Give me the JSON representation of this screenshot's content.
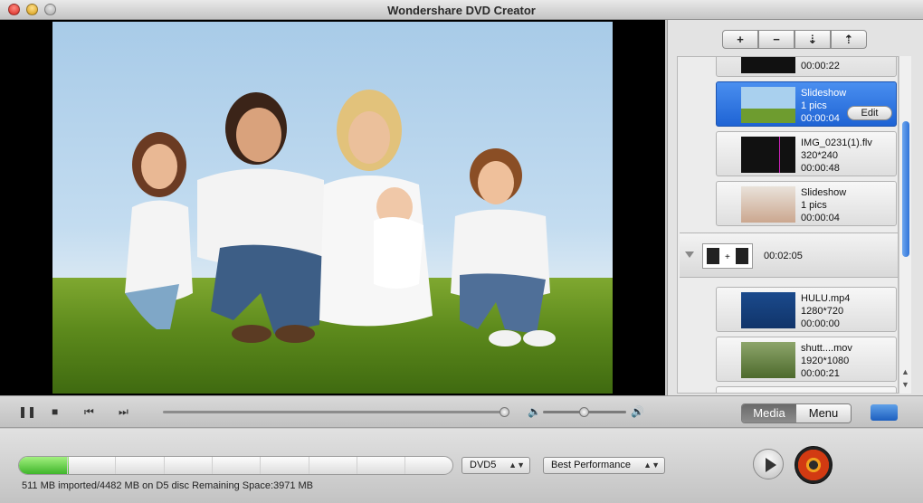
{
  "window": {
    "title": "Wondershare DVD Creator"
  },
  "toolbar": {
    "add": "+",
    "remove": "−",
    "move_down": "⇣",
    "move_up": "⇡"
  },
  "media_list": {
    "items": [
      {
        "line1": "00:00:22",
        "line2": "",
        "line3": ""
      },
      {
        "line1": "Slideshow",
        "line2": "1 pics",
        "line3": "00:00:04",
        "edit": "Edit"
      },
      {
        "line1": "IMG_0231(1).flv",
        "line2": "320*240",
        "line3": "00:00:48"
      },
      {
        "line1": "Slideshow",
        "line2": "1 pics",
        "line3": "00:00:04"
      },
      {
        "line1": "00:02:05"
      },
      {
        "line1": "HULU.mp4",
        "line2": "1280*720",
        "line3": "00:00:00"
      },
      {
        "line1": "shutt....mov",
        "line2": "1920*1080",
        "line3": "00:00:21"
      }
    ]
  },
  "playback": {
    "seek_value": 1.0,
    "volume_value": 0.5
  },
  "tabs": {
    "media": "Media",
    "menu": "Menu"
  },
  "bottom": {
    "progress": 0.114,
    "disc_type": "DVD5",
    "quality": "Best Performance",
    "status": "511 MB imported/4482 MB on D5 disc   Remaining Space:3971 MB"
  },
  "colors": {
    "selection": "#1e63d4",
    "progress": "#3fb52b",
    "burn": "#d23a12"
  }
}
